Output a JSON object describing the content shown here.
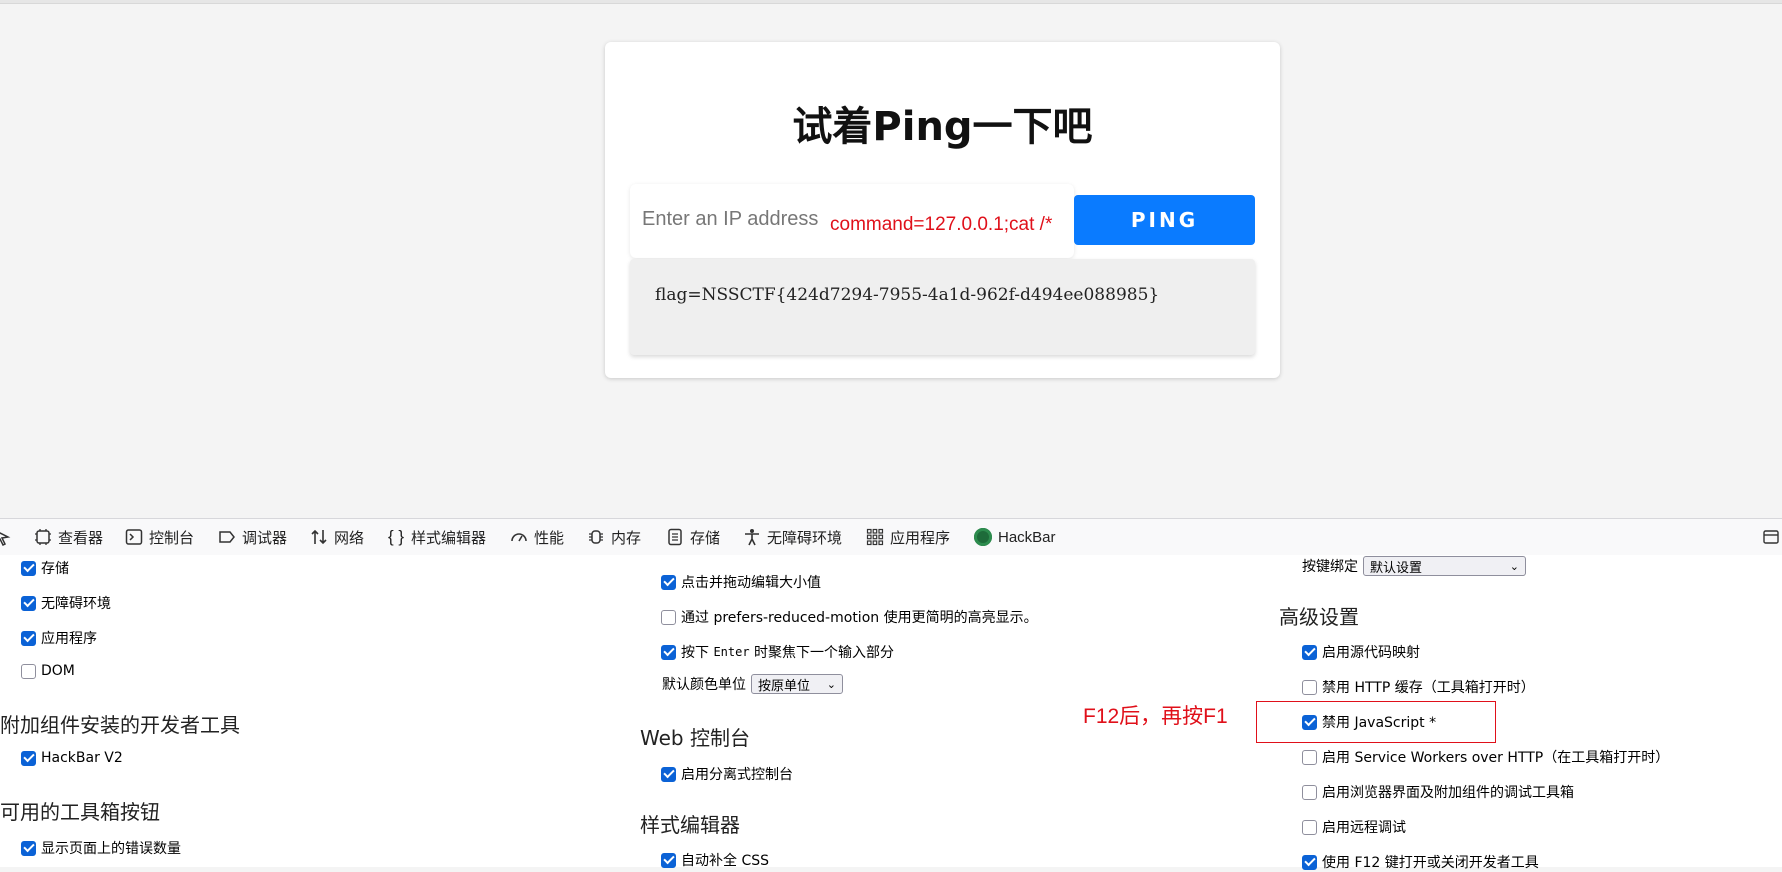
{
  "page": {
    "title": "试着Ping一下吧",
    "ip_placeholder": "Enter an IP address",
    "annotation_command": "command=127.0.0.1;cat /*",
    "ping_button": "PING",
    "output": "flag=NSSCTF{424d7294-7955-4a1d-962f-d494ee088985}"
  },
  "devtools": {
    "tabs": [
      {
        "label": "查看器",
        "icon": "inspector-icon"
      },
      {
        "label": "控制台",
        "icon": "console-icon"
      },
      {
        "label": "调试器",
        "icon": "debugger-icon"
      },
      {
        "label": "网络",
        "icon": "network-icon"
      },
      {
        "label": "样式编辑器",
        "icon": "style-editor-icon"
      },
      {
        "label": "性能",
        "icon": "performance-icon"
      },
      {
        "label": "内存",
        "icon": "memory-icon"
      },
      {
        "label": "存储",
        "icon": "storage-icon"
      },
      {
        "label": "无障碍环境",
        "icon": "accessibility-icon"
      },
      {
        "label": "应用程序",
        "icon": "application-icon"
      },
      {
        "label": "HackBar",
        "icon": "hackbar-icon"
      }
    ]
  },
  "settings": {
    "col1": {
      "opt_storage": "存储",
      "opt_a11y": "无障碍环境",
      "opt_app": "应用程序",
      "opt_dom": "DOM",
      "sec_addons": "附加组件安装的开发者工具",
      "opt_hackbar": "HackBar V2",
      "sec_toolbox": "可用的工具箱按钮",
      "opt_errors": "显示页面上的错误数量"
    },
    "col2": {
      "opt_drag": "点击并拖动编辑大小值",
      "opt_motion": "通过 prefers-reduced-motion 使用更简明的高亮显示。",
      "opt_enter_pre": "按下",
      "opt_enter_key": "Enter",
      "opt_enter_post": "时聚焦下一个输入部分",
      "color_unit_label": "默认颜色单位",
      "color_unit_value": "按原单位",
      "sec_console": "Web 控制台",
      "opt_split_console": "启用分离式控制台",
      "sec_style": "样式编辑器",
      "opt_autocomplete": "自动补全 CSS"
    },
    "col3": {
      "keybinding_label": "按键绑定",
      "keybinding_value": "默认设置",
      "sec_advanced": "高级设置",
      "opt_sourcemaps": "启用源代码映射",
      "opt_http_cache": "禁用 HTTP 缓存（工具箱打开时）",
      "opt_disable_js": "禁用 JavaScript *",
      "opt_service_workers": "启用 Service Workers over HTTP（在工具箱打开时）",
      "opt_chrome_debug": "启用浏览器界面及附加组件的调试工具箱",
      "opt_remote_debug": "启用远程调试",
      "opt_f12": "使用 F12 键打开或关闭开发者工具"
    },
    "annotation_note": "F12后，再按F1",
    "checked": {
      "storage": true,
      "a11y": true,
      "app": true,
      "dom": false,
      "hackbar": true,
      "errors": true,
      "drag": true,
      "motion": false,
      "enter": true,
      "split_console": true,
      "autocomplete": true,
      "sourcemaps": true,
      "http_cache": false,
      "disable_js": true,
      "service_workers": false,
      "chrome_debug": false,
      "remote_debug": false,
      "f12": true
    }
  },
  "colors": {
    "ping_button": "#0a7bff",
    "annotation": "#e0101a",
    "checkbox": "#0b62d6"
  }
}
